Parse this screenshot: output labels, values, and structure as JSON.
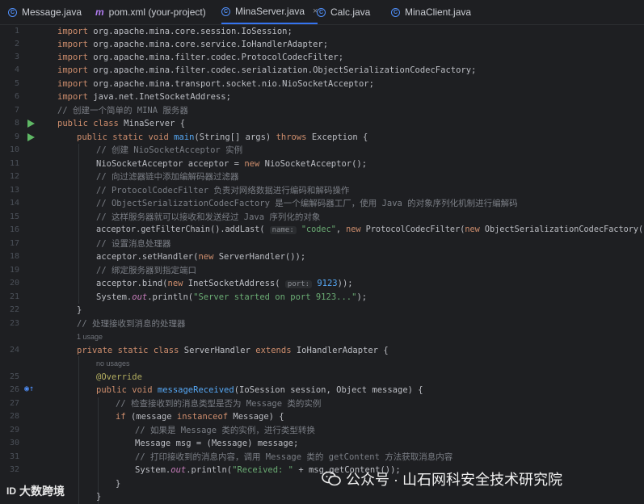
{
  "tabs": [
    {
      "label": "Message.java",
      "icon": "class-icon",
      "active": false
    },
    {
      "label": "pom.xml (your-project)",
      "icon": "maven-icon",
      "active": false
    },
    {
      "label": "MinaServer.java",
      "icon": "class-icon",
      "active": true,
      "close": "×"
    },
    {
      "label": "Calc.java",
      "icon": "class-icon",
      "active": false
    },
    {
      "label": "MinaClient.java",
      "icon": "class-icon",
      "active": false
    }
  ],
  "colors": {
    "accent": "#3574f0",
    "keyword": "#cf8e6d",
    "comment": "#7a7e85",
    "string": "#6aab73",
    "function": "#56a8f5",
    "run": "#5fb865"
  },
  "code": {
    "n1": "1",
    "n2": "2",
    "n3": "3",
    "n4": "4",
    "n5": "5",
    "n6": "6",
    "n7": "7",
    "n8": "8",
    "n9": "9",
    "n10": "10",
    "n11": "11",
    "n12": "12",
    "n13": "13",
    "n14": "14",
    "n15": "15",
    "n16": "16",
    "n17": "17",
    "n18": "18",
    "n19": "19",
    "n20": "20",
    "n21": "21",
    "n22": "22",
    "n23": "23",
    "n24": "24",
    "n25": "25",
    "n26": "26",
    "n27": "27",
    "n28": "28",
    "n29": "29",
    "n30": "30",
    "n31": "31",
    "n32": "32",
    "imp": "import",
    "l1": " org.apache.mina.core.session.IoSession;",
    "l2": " org.apache.mina.core.service.IoHandlerAdapter;",
    "l3": " org.apache.mina.filter.codec.ProtocolCodecFilter;",
    "l4": " org.apache.mina.filter.codec.serialization.ObjectSerializationCodecFactory;",
    "l5": " org.apache.mina.transport.socket.nio.NioSocketAcceptor;",
    "l6": " java.net.InetSocketAddress;",
    "l7": "// 创建一个简单的 MINA 服务器",
    "l8_kw": "public class",
    "l8_rest": " MinaServer {",
    "l9_kw1": "public static void",
    "l9_fn": "main",
    "l9_mid": "(String[] args) ",
    "l9_kw2": "throws",
    "l9_end": " Exception {",
    "l10": "// 创建 NioSocketAcceptor 实例",
    "l11_a": "NioSocketAcceptor acceptor = ",
    "l11_kw": "new",
    "l11_b": " NioSocketAcceptor();",
    "l12": "// 向过滤器链中添加编解码器过滤器",
    "l13": "// ProtocolCodecFilter 负责对网络数据进行编码和解码操作",
    "l14": "// ObjectSerializationCodecFactory 是一个编解码器工厂，使用 Java 的对象序列化机制进行编解码",
    "l15": "// 这样服务器就可以接收和发送经过 Java 序列化的对象",
    "l16_a": "acceptor.getFilterChain().addLast( ",
    "l16_hint": "name:",
    "l16_str": " \"codec\"",
    "l16_b": ", ",
    "l16_kw1": "new",
    "l16_c": " ProtocolCodecFilter(",
    "l16_kw2": "new",
    "l16_d": " ObjectSerializationCodecFactory()));",
    "l17": "// 设置消息处理器",
    "l18_a": "acceptor.setHandler(",
    "l18_kw": "new",
    "l18_b": " ServerHandler());",
    "l19": "// 绑定服务器到指定端口",
    "l20_a": "acceptor.bind(",
    "l20_kw": "new",
    "l20_b": " InetSocketAddress( ",
    "l20_hint": "port:",
    "l20_num": " 9123",
    "l20_c": "));",
    "l21_a": "System.",
    "l21_out": "out",
    "l21_b": ".println(",
    "l21_str": "\"Server started on port 9123...\"",
    "l21_c": ");",
    "l22": "}",
    "l23": "// 处理接收到消息的处理器",
    "usage1": "1 usage",
    "l24_kw": "private static class",
    "l24_b": " ServerHandler ",
    "l24_kw2": "extends",
    "l24_c": " IoHandlerAdapter {",
    "usage2": "no usages",
    "l25": "@Override",
    "l26_kw": "public void",
    "l26_fn": " messageReceived",
    "l26_b": "(IoSession session, Object message) {",
    "l27": "// 检查接收到的消息类型是否为 Message 类的实例",
    "l28_kw": "if",
    "l28_a": " (message ",
    "l28_kw2": "instanceof",
    "l28_b": " Message) {",
    "l29": "// 如果是 Message 类的实例，进行类型转换",
    "l30": "Message msg = (Message) message;",
    "l31": "// 打印接收到的消息内容，调用 Message 类的 getContent 方法获取消息内容",
    "l32_a": "System.",
    "l32_out": "out",
    "l32_b": ".println(",
    "l32_str": "\"Received: \"",
    "l32_c": " + msg.getContent());",
    "l33": "}",
    "l34": "}"
  },
  "watermark": {
    "left_logo": "ID",
    "left_text": "大数跨境",
    "right_text": "公众号 · 山石网科安全技术研究院"
  }
}
